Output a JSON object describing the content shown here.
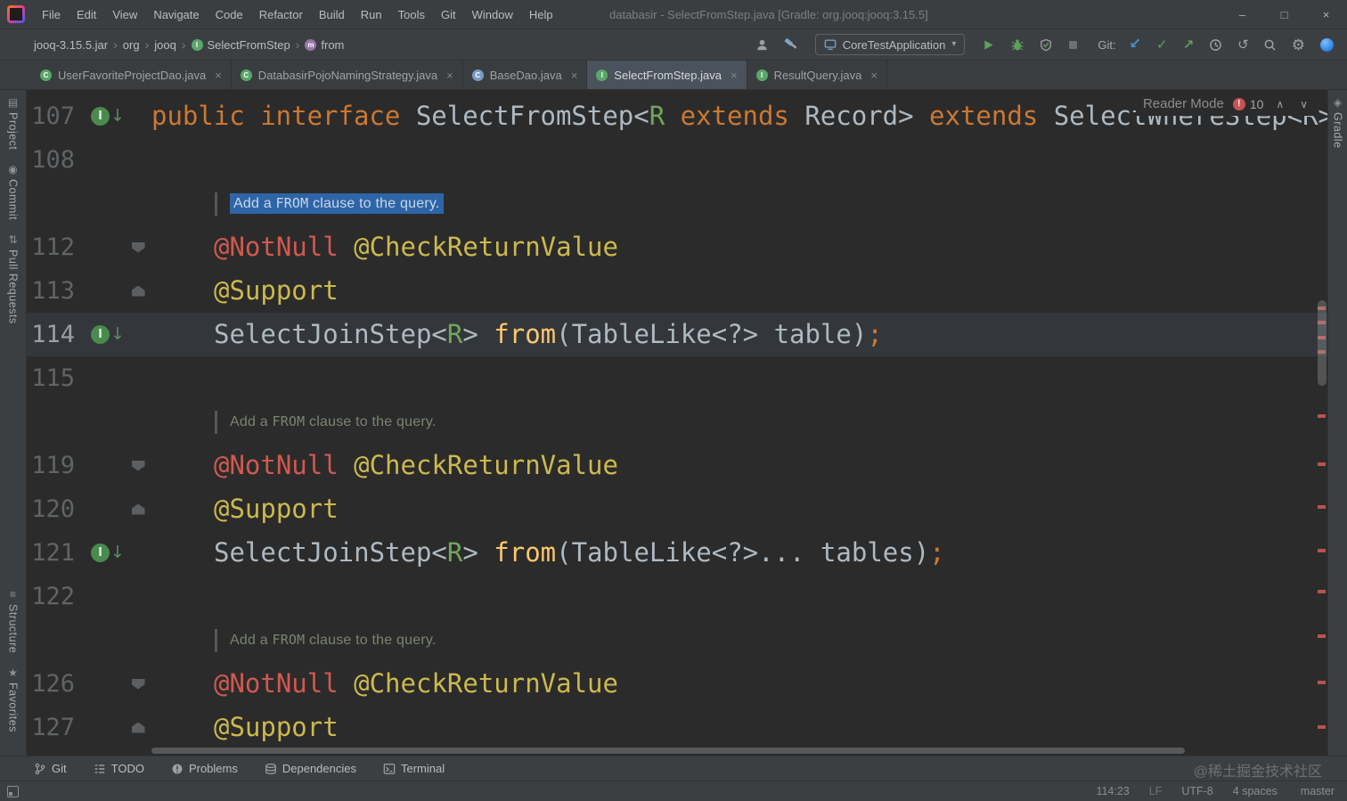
{
  "colors": {
    "tokens": {
      "keyword": "#cc7832",
      "plain": "#aeb9c2",
      "typeparam": "#6fa65a",
      "method": "#ffc66d",
      "annotation": "#ccb94d",
      "error_annotation": "#d1594f"
    },
    "doc_text": "#7a8570",
    "doc_selection_bg": "#2e65a7",
    "doc_selection_text": "#c7d7ea",
    "error_stripe": "#b8544d",
    "run_green": "#5ca05c",
    "accent_blue": "#4393d6"
  },
  "title_bar": {
    "menu_items": [
      "File",
      "Edit",
      "View",
      "Navigate",
      "Code",
      "Refactor",
      "Build",
      "Run",
      "Tools",
      "Git",
      "Window",
      "Help"
    ],
    "window_title": "databasir - SelectFromStep.java [Gradle: org.jooq:jooq:3.15.5]",
    "window_controls": [
      {
        "name": "minimize-button",
        "glyph": "min"
      },
      {
        "name": "maximize-button",
        "glyph": "max"
      },
      {
        "name": "close-button",
        "glyph": "close"
      }
    ]
  },
  "nav_bar": {
    "separator": "›",
    "breadcrumbs": [
      {
        "label": "jooq-3.15.5.jar"
      },
      {
        "label": "org"
      },
      {
        "label": "jooq"
      },
      {
        "label": "SelectFromStep",
        "icon": "interface"
      },
      {
        "label": "from",
        "icon": "method"
      }
    ],
    "right": {
      "icons_start": [
        {
          "name": "collab-users"
        },
        {
          "name": "build-hammer"
        }
      ],
      "run_config": {
        "icon": "app-monitor",
        "label": "CoreTestApplication"
      },
      "run_actions": [
        {
          "name": "run-play"
        },
        {
          "name": "debug-bug"
        },
        {
          "name": "run-coverage"
        },
        {
          "name": "stop"
        }
      ],
      "git_label": "Git:",
      "git_actions": [
        {
          "name": "update-project"
        },
        {
          "name": "commit-check"
        },
        {
          "name": "push"
        },
        {
          "name": "history-clock"
        },
        {
          "name": "rollback"
        }
      ],
      "icons_end": [
        {
          "name": "search"
        },
        {
          "name": "settings-gear"
        },
        {
          "name": "sync-sphere"
        }
      ]
    }
  },
  "tab_bar": {
    "tabs": [
      {
        "label": "UserFavoriteProjectDao.java",
        "icon_letter": "C",
        "icon_color": "#59a869",
        "active": false
      },
      {
        "label": "DatabasirPojoNamingStrategy.java",
        "icon_letter": "C",
        "icon_color": "#59a869",
        "active": false
      },
      {
        "label": "BaseDao.java",
        "icon_letter": "C",
        "icon_color": "#7a9cc0",
        "active": false
      },
      {
        "label": "SelectFromStep.java",
        "icon_letter": "I",
        "icon_color": "#59a869",
        "active": true
      },
      {
        "label": "ResultQuery.java",
        "icon_letter": "I",
        "icon_color": "#59a869",
        "active": false
      }
    ]
  },
  "reader_panel": {
    "label": "Reader Mode",
    "error_count": "10"
  },
  "tool_strips": {
    "left_top": [
      {
        "label": "Project",
        "icon": "project-folder"
      },
      {
        "label": "Commit",
        "icon": "commit"
      },
      {
        "label": "Pull Requests",
        "icon": "pull-requests"
      }
    ],
    "left_bottom": [
      {
        "label": "Structure",
        "icon": "structure"
      },
      {
        "label": "Favorites",
        "icon": "favorites"
      }
    ],
    "right_top": [
      {
        "label": "Gradle",
        "icon": "gradle"
      }
    ]
  },
  "editor": {
    "javadoc_parts": [
      {
        "t": "Add a ",
        "mono": false
      },
      {
        "t": "FROM",
        "mono": true
      },
      {
        "t": " clause to the query.",
        "mono": false
      }
    ],
    "rows": [
      {
        "num": "107",
        "kind": "code",
        "gutter": "implemented",
        "indent": 0,
        "tokens": [
          {
            "t": "public interface ",
            "c": "keyword"
          },
          {
            "t": "SelectFromStep<",
            "c": "plain"
          },
          {
            "t": "R",
            "c": "typeparam"
          },
          {
            "t": " ",
            "c": "plain"
          },
          {
            "t": "extends ",
            "c": "keyword"
          },
          {
            "t": "Record> ",
            "c": "plain"
          },
          {
            "t": "extends ",
            "c": "keyword"
          },
          {
            "t": "SelectWhereStep<R>",
            "c": "plain"
          }
        ]
      },
      {
        "num": "108",
        "kind": "blank"
      },
      {
        "kind": "doc",
        "selected": true
      },
      {
        "num": "112",
        "kind": "code",
        "fold": "down",
        "indent": 1,
        "tokens": [
          {
            "t": "@NotNull ",
            "c": "error_annotation"
          },
          {
            "t": "@CheckReturnValue",
            "c": "annotation"
          }
        ]
      },
      {
        "num": "113",
        "kind": "code",
        "fold": "up",
        "indent": 1,
        "tokens": [
          {
            "t": "@Support",
            "c": "annotation"
          }
        ]
      },
      {
        "num": "114",
        "kind": "code",
        "current": true,
        "gutter": "implemented",
        "indent": 1,
        "tokens": [
          {
            "t": "SelectJoinStep<",
            "c": "plain"
          },
          {
            "t": "R",
            "c": "typeparam"
          },
          {
            "t": "> ",
            "c": "plain"
          },
          {
            "t": "from",
            "c": "method"
          },
          {
            "t": "(TableLike<?> table)",
            "c": "plain"
          },
          {
            "t": ";",
            "c": "keyword"
          }
        ]
      },
      {
        "num": "115",
        "kind": "blank"
      },
      {
        "kind": "doc",
        "selected": false
      },
      {
        "num": "119",
        "kind": "code",
        "fold": "down",
        "indent": 1,
        "tokens": [
          {
            "t": "@NotNull ",
            "c": "error_annotation"
          },
          {
            "t": "@CheckReturnValue",
            "c": "annotation"
          }
        ]
      },
      {
        "num": "120",
        "kind": "code",
        "fold": "up",
        "indent": 1,
        "tokens": [
          {
            "t": "@Support",
            "c": "annotation"
          }
        ]
      },
      {
        "num": "121",
        "kind": "code",
        "gutter": "implemented",
        "indent": 1,
        "tokens": [
          {
            "t": "SelectJoinStep<",
            "c": "plain"
          },
          {
            "t": "R",
            "c": "typeparam"
          },
          {
            "t": "> ",
            "c": "plain"
          },
          {
            "t": "from",
            "c": "method"
          },
          {
            "t": "(TableLike<?>... tables)",
            "c": "plain"
          },
          {
            "t": ";",
            "c": "keyword"
          }
        ]
      },
      {
        "num": "122",
        "kind": "blank"
      },
      {
        "kind": "doc",
        "selected": false
      },
      {
        "num": "126",
        "kind": "code",
        "fold": "down",
        "indent": 1,
        "tokens": [
          {
            "t": "@NotNull ",
            "c": "error_annotation"
          },
          {
            "t": "@CheckReturnValue",
            "c": "annotation"
          }
        ]
      },
      {
        "num": "127",
        "kind": "code",
        "fold": "up",
        "indent": 1,
        "tokens": [
          {
            "t": "@Support",
            "c": "annotation"
          }
        ]
      }
    ]
  },
  "bottom_bar": {
    "items": [
      {
        "label": "Git",
        "icon": "git-branch"
      },
      {
        "label": "TODO",
        "icon": "todo-list"
      },
      {
        "label": "Problems",
        "icon": "problems"
      },
      {
        "label": "Dependencies",
        "icon": "dependencies"
      },
      {
        "label": "Terminal",
        "icon": "terminal"
      }
    ]
  },
  "status_bar": {
    "caret_position": "114:23",
    "line_separator": "LF",
    "encoding": "UTF-8",
    "indent": "4 spaces",
    "git_branch": "master"
  },
  "watermark": "@稀土掘金技术社区"
}
